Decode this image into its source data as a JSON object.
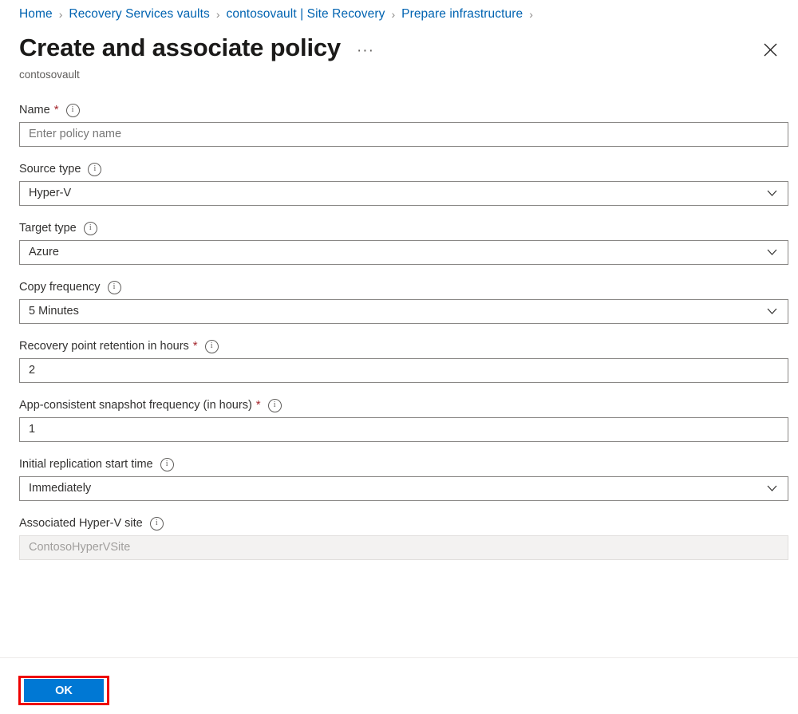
{
  "breadcrumb": {
    "separator": "›",
    "items": [
      {
        "label": "Home"
      },
      {
        "label": "Recovery Services vaults"
      },
      {
        "label": "contosovault | Site Recovery"
      },
      {
        "label": "Prepare infrastructure"
      }
    ]
  },
  "header": {
    "title": "Create and associate policy",
    "more_label": "···",
    "subtitle": "contosovault",
    "close_label": "Close"
  },
  "form": {
    "info_glyph": "i",
    "required_glyph": "*",
    "fields": [
      {
        "label": "Name",
        "required": true,
        "type": "text",
        "value": "",
        "placeholder": "Enter policy name"
      },
      {
        "label": "Source type",
        "required": false,
        "type": "select",
        "value": "Hyper-V",
        "placeholder": ""
      },
      {
        "label": "Target type",
        "required": false,
        "type": "select",
        "value": "Azure",
        "placeholder": ""
      },
      {
        "label": "Copy frequency",
        "required": false,
        "type": "select",
        "value": "5 Minutes",
        "placeholder": ""
      },
      {
        "label": "Recovery point retention in hours",
        "required": true,
        "type": "text",
        "value": "2",
        "placeholder": ""
      },
      {
        "label": "App-consistent snapshot frequency (in hours)",
        "required": true,
        "type": "text",
        "value": "1",
        "placeholder": ""
      },
      {
        "label": "Initial replication start time",
        "required": false,
        "type": "select",
        "value": "Immediately",
        "placeholder": ""
      },
      {
        "label": "Associated Hyper-V site",
        "required": false,
        "type": "disabled",
        "value": "ContosoHyperVSite",
        "placeholder": ""
      }
    ]
  },
  "footer": {
    "ok_label": "OK"
  },
  "colors": {
    "link": "#0063b1",
    "primary_button": "#0078d4",
    "required_asterisk": "#a4262c",
    "highlight_box": "#ee0000",
    "border": "#8a8886",
    "disabled_background": "#f3f2f1"
  }
}
